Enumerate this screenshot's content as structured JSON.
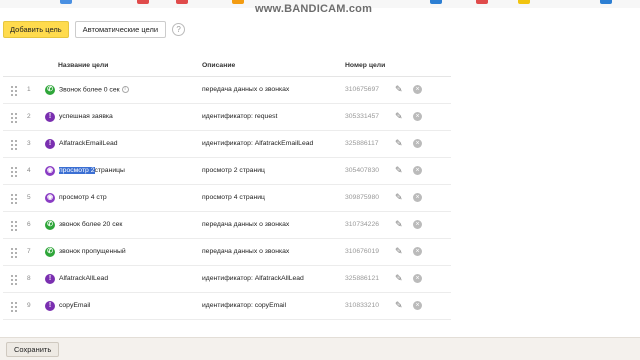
{
  "watermark": "www.BANDICAM.com",
  "toolbar": {
    "add_goal": "Добавить цель",
    "auto_goals": "Автоматические цели",
    "help": "?"
  },
  "table": {
    "columns": {
      "name": "Название цели",
      "description": "Описание",
      "number": "Номер цели"
    },
    "rows": [
      {
        "idx": "1",
        "icon": "phone-icon",
        "name_a": "",
        "name_sel": "",
        "name_b": "Звонок более 0 сек",
        "info": true,
        "description": "передача данных о звонках",
        "number": "310675697"
      },
      {
        "idx": "2",
        "icon": "javascript-event-icon",
        "name_a": "",
        "name_sel": "",
        "name_b": "успешная заявка",
        "info": false,
        "description": "идентификатор: request",
        "number": "305331457"
      },
      {
        "idx": "3",
        "icon": "javascript-event-icon",
        "name_a": "",
        "name_sel": "",
        "name_b": "AlfatrackEmailLead",
        "info": false,
        "description": "идентификатор: AlfatrackEmailLead",
        "number": "325886117"
      },
      {
        "idx": "4",
        "icon": "page-views-icon",
        "name_a": "",
        "name_sel": "просмотр 2",
        "name_b": "страницы",
        "info": false,
        "description": "просмотр 2 страниц",
        "number": "305407830"
      },
      {
        "idx": "5",
        "icon": "page-views-icon",
        "name_a": "",
        "name_sel": "",
        "name_b": "просмотр 4 стр",
        "info": false,
        "description": "просмотр 4 страниц",
        "number": "309875980"
      },
      {
        "idx": "6",
        "icon": "phone-icon",
        "name_a": "",
        "name_sel": "",
        "name_b": "звонок более 20 сек",
        "info": false,
        "description": "передача данных о звонках",
        "number": "310734226"
      },
      {
        "idx": "7",
        "icon": "phone-icon",
        "name_a": "",
        "name_sel": "",
        "name_b": "звонок пропущенный",
        "info": false,
        "description": "передача данных о звонках",
        "number": "310676019"
      },
      {
        "idx": "8",
        "icon": "javascript-event-icon",
        "name_a": "",
        "name_sel": "",
        "name_b": "AlfatrackAllLead",
        "info": false,
        "description": "идентификатор: AlfatrackAllLead",
        "number": "325886121"
      },
      {
        "idx": "9",
        "icon": "javascript-event-icon",
        "name_a": "",
        "name_sel": "",
        "name_b": "copyEmail",
        "info": false,
        "description": "идентификатор: copyEmail",
        "number": "310833210"
      }
    ]
  },
  "footer": {
    "save": "Сохранить"
  },
  "colors": {
    "primary_button": "#ffdb4d",
    "phone_icon": "#2fa63a",
    "js_icon": "#7a2fb0",
    "selection": "#3b6fd3"
  }
}
